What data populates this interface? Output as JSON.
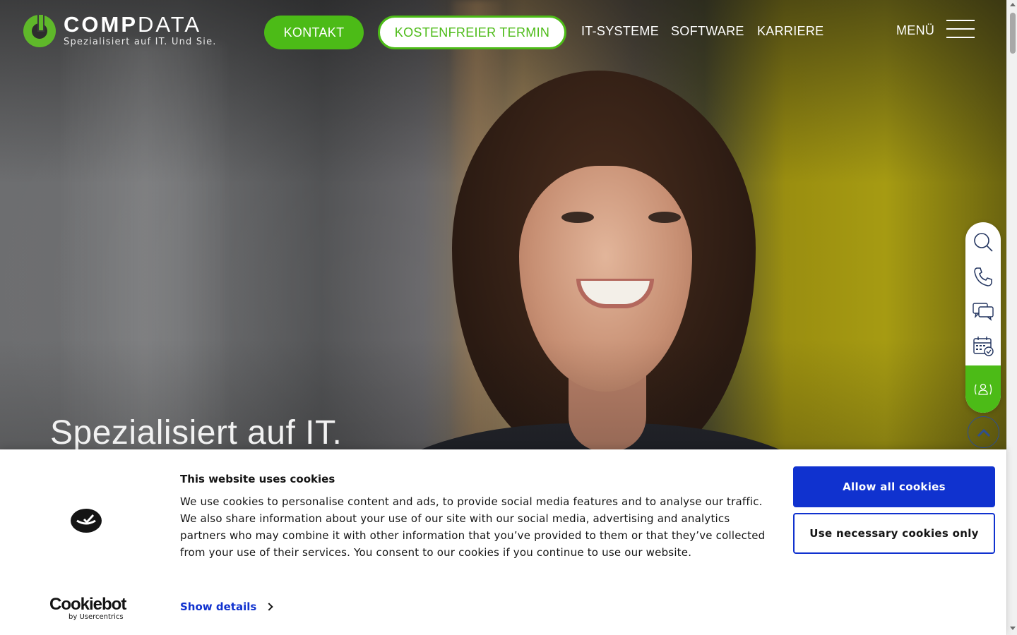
{
  "header": {
    "logo": {
      "brand_bold": "COMP",
      "brand_light": "DATA",
      "tagline": "Spezialisiert auf IT. Und Sie."
    },
    "kontakt_label": "KONTAKT",
    "termin_label": "KOSTENFREIER TERMIN",
    "nav": [
      {
        "label": "IT-SYSTEME"
      },
      {
        "label": "SOFTWARE"
      },
      {
        "label": "KARRIERE"
      }
    ],
    "menu_label": "MENÜ"
  },
  "hero": {
    "headline": "Spezialisiert auf IT."
  },
  "sidebar": {
    "items": [
      {
        "icon": "search-icon"
      },
      {
        "icon": "phone-icon"
      },
      {
        "icon": "chat-icon"
      },
      {
        "icon": "calendar-icon"
      },
      {
        "icon": "contact-person-icon"
      }
    ],
    "scroll_top_icon": "chevron-up-icon"
  },
  "cookie_banner": {
    "title": "This website uses cookies",
    "text": "We use cookies to personalise content and ads, to provide social media features and to analyse our traffic. We also share information about your use of our site with our social media, advertising and analytics partners who may combine it with other information that you’ve provided to them or that they’ve collected from your use of their services. You consent to our cookies if you continue to use our website.",
    "show_details": "Show details",
    "allow_all": "Allow all cookies",
    "necessary_only": "Use necessary cookies only",
    "brand_name": "Cookiebot",
    "brand_by": "by Usercentrics"
  },
  "colors": {
    "brand_green": "#4cbb17",
    "cookie_blue": "#1032cf",
    "text_dark": "#141414"
  }
}
